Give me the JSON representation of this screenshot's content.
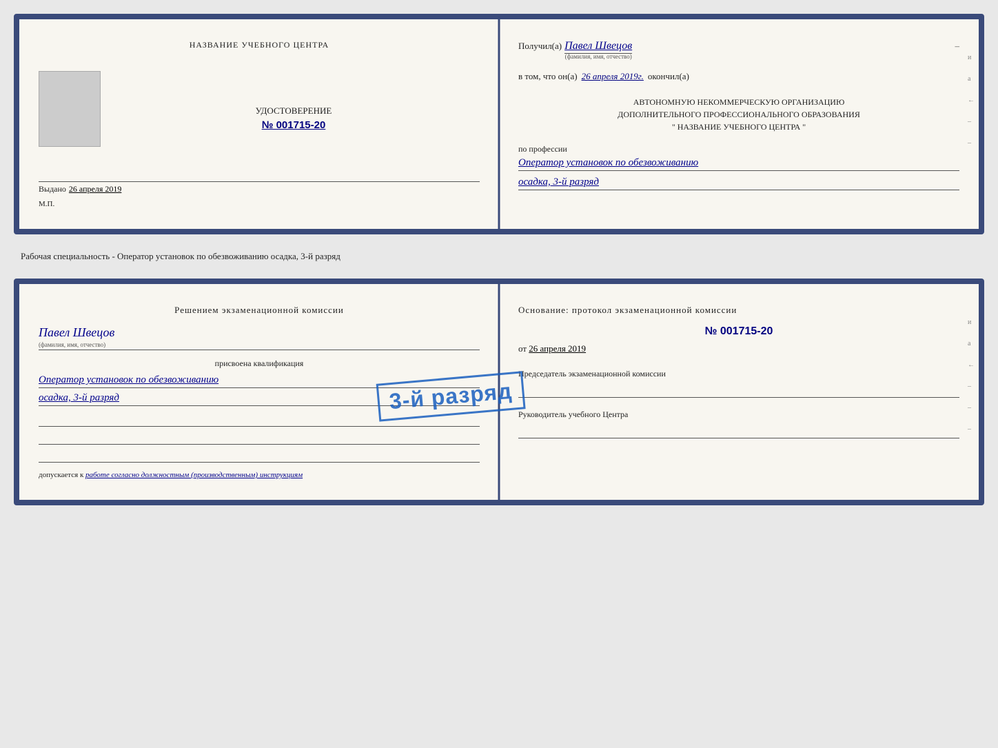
{
  "card1": {
    "left": {
      "center_title": "НАЗВАНИЕ УЧЕБНОГО ЦЕНТРА",
      "cert_label": "УДОСТОВЕРЕНИЕ",
      "cert_number": "№ 001715-20",
      "issued_label": "Выдано",
      "issued_date": "26 апреля 2019",
      "mp_label": "М.П."
    },
    "right": {
      "received_label": "Получил(а)",
      "received_name": "Павел Швецов",
      "received_name_sub": "(фамилия, имя, отчество)",
      "dash": "–",
      "vtom_label": "в том, что он(а)",
      "vtom_date": "26 апреля 2019г.",
      "okonchil": "окончил(а)",
      "org_line1": "АВТОНОМНУЮ НЕКОММЕРЧЕСКУЮ ОРГАНИЗАЦИЮ",
      "org_line2": "ДОПОЛНИТЕЛЬНОГО ПРОФЕССИОНАЛЬНОГО ОБРАЗОВАНИЯ",
      "org_line3": "\"   НАЗВАНИЕ УЧЕБНОГО ЦЕНТРА   \"",
      "po_professii": "по профессии",
      "profession_line1": "Оператор установок по обезвоживанию",
      "profession_line2": "осадка, 3-й разряд"
    }
  },
  "separator": {
    "text": "Рабочая специальность - Оператор установок по обезвоживанию осадка, 3-й разряд"
  },
  "card2": {
    "left": {
      "decision_title": "Решением  экзаменационной  комиссии",
      "name": "Павел Швецов",
      "name_sub": "(фамилия, имя, отчество)",
      "assigned_label": "присвоена квалификация",
      "qual_line1": "Оператор установок по обезвоживанию",
      "qual_line2": "осадка, 3-й разряд",
      "допускается_label": "допускается к",
      "допускается_val": "работе согласно должностным (производственным) инструкциям"
    },
    "right": {
      "osnov_label": "Основание: протокол экзаменационной  комиссии",
      "proto_number": "№  001715-20",
      "ot_label": "от",
      "ot_date": "26 апреля 2019",
      "pred_label": "Председатель экзаменационной комиссии",
      "ruk_label": "Руководитель учебного Центра",
      "stamp_text": "3-й разряд"
    }
  },
  "right_marks": [
    "и",
    "а",
    "←",
    "–",
    "–",
    "–",
    "–",
    "–"
  ]
}
